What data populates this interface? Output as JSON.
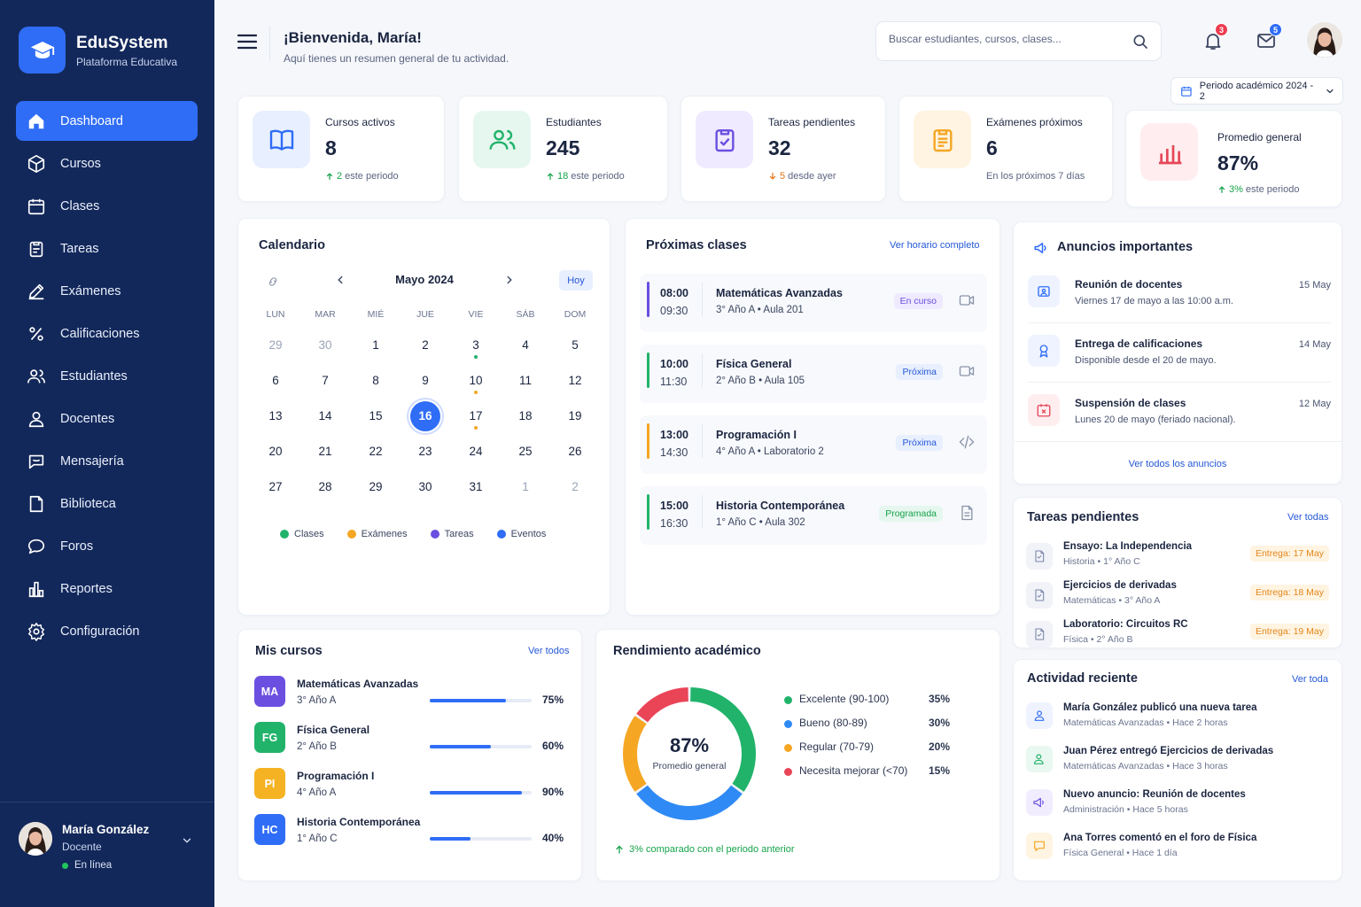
{
  "brand": {
    "name": "EduSystem",
    "subtitle": "Plataforma Educativa"
  },
  "nav": [
    {
      "label": "Dashboard",
      "icon": "home-icon",
      "active": true
    },
    {
      "label": "Cursos",
      "icon": "cube-icon"
    },
    {
      "label": "Clases",
      "icon": "calendar-icon"
    },
    {
      "label": "Tareas",
      "icon": "clipboard-icon"
    },
    {
      "label": "Exámenes",
      "icon": "pen-icon"
    },
    {
      "label": "Calificaciones",
      "icon": "grades-icon"
    },
    {
      "label": "Estudiantes",
      "icon": "users-icon"
    },
    {
      "label": "Docentes",
      "icon": "user-icon"
    },
    {
      "label": "Mensajería",
      "icon": "chat-icon"
    },
    {
      "label": "Biblioteca",
      "icon": "book-icon"
    },
    {
      "label": "Foros",
      "icon": "forum-icon"
    },
    {
      "label": "Reportes",
      "icon": "chart-icon"
    },
    {
      "label": "Configuración",
      "icon": "gear-icon"
    }
  ],
  "user": {
    "name": "María González",
    "role": "Docente",
    "status": "En línea"
  },
  "header": {
    "title": "¡Bienvenida, María!",
    "subtitle": "Aquí tienes un resumen general de tu actividad.",
    "search_placeholder": "Buscar estudiantes, cursos, clases...",
    "notifications": "3",
    "messages": "5",
    "period": "Periodo académico 2024 - 2"
  },
  "stats": [
    {
      "label": "Cursos activos",
      "value": "8",
      "delta": "2",
      "note": "este periodo",
      "trend": "up"
    },
    {
      "label": "Estudiantes",
      "value": "245",
      "delta": "18",
      "note": "este periodo",
      "trend": "up"
    },
    {
      "label": "Tareas pendientes",
      "value": "32",
      "delta": "5",
      "note": "desde ayer",
      "trend": "down"
    },
    {
      "label": "Exámenes próximos",
      "value": "6",
      "delta": "",
      "note": "En los próximos 7 días",
      "trend": "none"
    },
    {
      "label": "Promedio general",
      "value": "87%",
      "delta": "3%",
      "note": "este periodo",
      "trend": "up"
    }
  ],
  "calendar": {
    "title": "Calendario",
    "month": "Mayo 2024",
    "today_label": "Hoy",
    "weekdays": [
      "LUN",
      "MAR",
      "MIÉ",
      "JUE",
      "VIE",
      "SÁB",
      "DOM"
    ],
    "weeks": [
      [
        {
          "d": "29",
          "m": true
        },
        {
          "d": "30",
          "m": true
        },
        {
          "d": "1"
        },
        {
          "d": "2"
        },
        {
          "d": "3",
          "mark": "clases"
        },
        {
          "d": "4"
        },
        {
          "d": "5"
        }
      ],
      [
        {
          "d": "6"
        },
        {
          "d": "7"
        },
        {
          "d": "8"
        },
        {
          "d": "9"
        },
        {
          "d": "10",
          "mark": "examenes"
        },
        {
          "d": "11"
        },
        {
          "d": "12"
        }
      ],
      [
        {
          "d": "13"
        },
        {
          "d": "14"
        },
        {
          "d": "15"
        },
        {
          "d": "16",
          "today": true
        },
        {
          "d": "17",
          "mark": "examenes"
        },
        {
          "d": "18"
        },
        {
          "d": "19"
        }
      ],
      [
        {
          "d": "20"
        },
        {
          "d": "21"
        },
        {
          "d": "22"
        },
        {
          "d": "23"
        },
        {
          "d": "24"
        },
        {
          "d": "25"
        },
        {
          "d": "26"
        }
      ],
      [
        {
          "d": "27"
        },
        {
          "d": "28"
        },
        {
          "d": "29"
        },
        {
          "d": "30"
        },
        {
          "d": "31"
        },
        {
          "d": "1",
          "m": true
        },
        {
          "d": "2",
          "m": true
        }
      ]
    ],
    "legend": [
      {
        "label": "Clases",
        "color": "#22b36b"
      },
      {
        "label": "Exámenes",
        "color": "#f5a623"
      },
      {
        "label": "Tareas",
        "color": "#6b4fe0"
      },
      {
        "label": "Eventos",
        "color": "#2f6df6"
      }
    ]
  },
  "classes": {
    "title": "Próximas clases",
    "link": "Ver horario completo",
    "items": [
      {
        "start": "08:00",
        "end": "09:30",
        "name": "Matemáticas Avanzadas",
        "room": "3° Año A • Aula 201",
        "status": "En curso",
        "color": "#6b4fe0",
        "action": "video-icon"
      },
      {
        "start": "10:00",
        "end": "11:30",
        "name": "Física General",
        "room": "2° Año B • Aula 105",
        "status": "Próxima",
        "color": "#22b36b",
        "action": "video-icon"
      },
      {
        "start": "13:00",
        "end": "14:30",
        "name": "Programación I",
        "room": "4° Año A • Laboratorio 2",
        "status": "Próxima",
        "color": "#f5a623",
        "action": "code-icon"
      },
      {
        "start": "15:00",
        "end": "16:30",
        "name": "Historia Contemporánea",
        "room": "1° Año C • Aula 302",
        "status": "Programada",
        "color": "#22b36b",
        "action": "document-icon"
      }
    ]
  },
  "announcements": {
    "title": "Anuncios importantes",
    "link": "Ver todos los anuncios",
    "items": [
      {
        "title": "Reunión de docentes",
        "desc": "Viernes 17 de mayo a las 10:00 a.m.",
        "date": "15 May",
        "icon": "meeting-icon",
        "bg": "#eef3ff",
        "fg": "#2f6df6"
      },
      {
        "title": "Entrega de calificaciones",
        "desc": "Disponible desde el 20 de mayo.",
        "date": "14 May",
        "icon": "award-icon",
        "bg": "#eef3ff",
        "fg": "#2f6df6"
      },
      {
        "title": "Suspensión de clases",
        "desc": "Lunes 20 de mayo (feriado nacional).",
        "date": "12 May",
        "icon": "calendar-x-icon",
        "bg": "#ffeef0",
        "fg": "#e54757"
      }
    ]
  },
  "tasks": {
    "title": "Tareas pendientes",
    "link": "Ver todas",
    "items": [
      {
        "title": "Ensayo: La Independencia",
        "sub": "Historia • 1° Año C",
        "due": "Entrega: 17 May"
      },
      {
        "title": "Ejercicios de derivadas",
        "sub": "Matemáticas • 3° Año A",
        "due": "Entrega: 18 May"
      },
      {
        "title": "Laboratorio: Circuitos RC",
        "sub": "Física • 2° Año B",
        "due": "Entrega: 19 May"
      }
    ]
  },
  "activity": {
    "title": "Actividad reciente",
    "link": "Ver toda",
    "items": [
      {
        "text": "María González publicó una nueva tarea",
        "sub": "Matemáticas Avanzadas • Hace 2 horas",
        "bg": "#eef3ff",
        "fg": "#2f6df6",
        "icon": "user-task-icon"
      },
      {
        "text": "Juan Pérez entregó Ejercicios de derivadas",
        "sub": "Matemáticas Avanzadas • Hace 3 horas",
        "bg": "#e9f8f0",
        "fg": "#22b36b",
        "icon": "user-check-icon"
      },
      {
        "text": "Nuevo anuncio: Reunión de docentes",
        "sub": "Administración • Hace 5 horas",
        "bg": "#f1edff",
        "fg": "#6b4fe0",
        "icon": "megaphone-icon"
      },
      {
        "text": "Ana Torres comentó en el foro de Física",
        "sub": "Física General • Hace 1 día",
        "bg": "#fff4e2",
        "fg": "#f5a623",
        "icon": "comment-icon"
      }
    ]
  },
  "courses": {
    "title": "Mis cursos",
    "link": "Ver todos",
    "items": [
      {
        "abbr": "MA",
        "name": "Matemáticas Avanzadas",
        "sub": "3° Año A",
        "progress": 75,
        "pct": "75%",
        "color": "#6b4fe0"
      },
      {
        "abbr": "FG",
        "name": "Física General",
        "sub": "2° Año B",
        "progress": 60,
        "pct": "60%",
        "color": "#22b36b"
      },
      {
        "abbr": "PI",
        "name": "Programación I",
        "sub": "4° Año A",
        "progress": 90,
        "pct": "90%",
        "color": "#f5b323"
      },
      {
        "abbr": "HC",
        "name": "Historia Contemporánea",
        "sub": "1° Año C",
        "progress": 40,
        "pct": "40%",
        "color": "#2f6df6"
      }
    ]
  },
  "performance": {
    "title": "Rendimiento académico",
    "center_value": "87%",
    "center_label": "Promedio general",
    "footer": "3% comparado con el periodo anterior"
  },
  "chart_data": {
    "type": "pie",
    "title": "",
    "categories": [
      "Excelente (90-100)",
      "Bueno (80-89)",
      "Regular (70-79)",
      "Necesita mejorar (<70)"
    ],
    "values": [
      35,
      30,
      20,
      15
    ],
    "labels": [
      "35%",
      "30%",
      "20%",
      "15%"
    ],
    "colors": [
      "#22b36b",
      "#2f8af5",
      "#f5a623",
      "#ea4457"
    ]
  }
}
